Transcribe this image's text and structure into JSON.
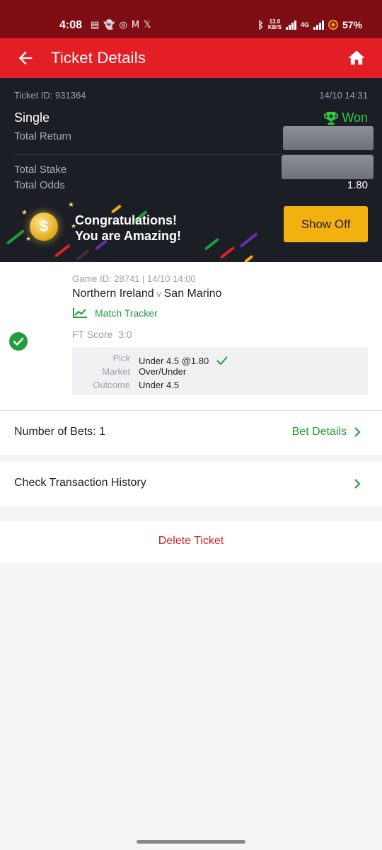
{
  "status_bar": {
    "time": "4:08",
    "network_speed": "13.0",
    "network_speed_unit": "KB/S",
    "network_type": "4G",
    "battery": "57%"
  },
  "header": {
    "title": "Ticket Details",
    "back_icon": "arrow-left",
    "home_icon": "home"
  },
  "ticket": {
    "id_label": "Ticket ID: 931364",
    "datetime": "14/10 14:31",
    "type": "Single",
    "status": "Won",
    "total_return_label": "Total Return",
    "total_stake_label": "Total Stake",
    "total_odds_label": "Total Odds",
    "total_odds_value": "1.80",
    "congrats_line1": "Congratulations!",
    "congrats_line2": "You are Amazing!",
    "show_off_label": "Show Off"
  },
  "bet": {
    "game_id": "Game ID: 28741 | 14/10 14:00",
    "home_team": "Northern Ireland",
    "vs": "v",
    "away_team": "San Marino",
    "tracker_label": "Match Tracker",
    "ft_label": "FT Score",
    "ft_score": "3:0",
    "pick_label": "Pick",
    "pick_value": "Under 4.5 @1.80",
    "market_label": "Market",
    "market_value": "Over/Under",
    "outcome_label": "Outcome",
    "outcome_value": "Under 4.5"
  },
  "summary": {
    "number_of_bets": "Number of Bets: 1",
    "bet_details": "Bet Details",
    "transaction_history": "Check Transaction History",
    "delete_ticket": "Delete Ticket"
  },
  "colors": {
    "status_bar": "#7e0e14",
    "header": "#e31e24",
    "dark_card": "#1b1e25",
    "won_green": "#2ecc40",
    "accent_green": "#1f9d3a",
    "show_off": "#f3b10f",
    "delete_red": "#c62828"
  }
}
